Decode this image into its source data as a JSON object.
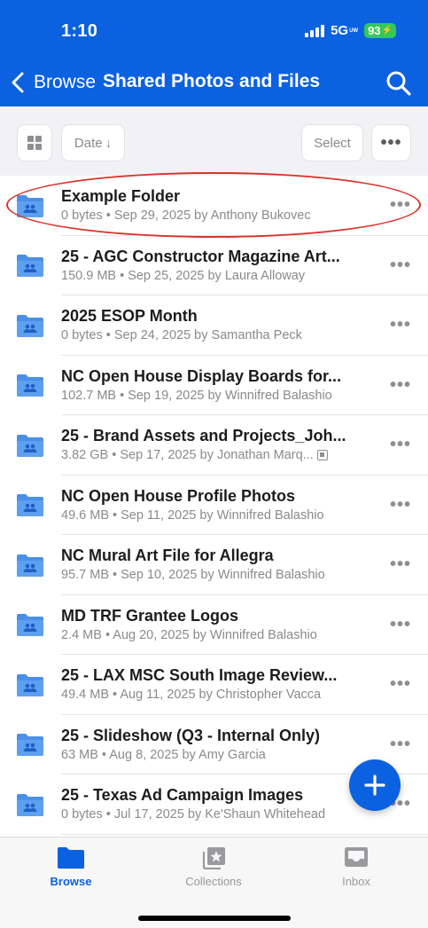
{
  "status_bar": {
    "time": "1:10",
    "network": "5G",
    "network_sub": "UW",
    "battery": "93"
  },
  "nav": {
    "back_label": "Browse",
    "title": "Shared Photos and Files"
  },
  "toolbar": {
    "sort_label": "Date",
    "select_label": "Select",
    "more_label": "•••"
  },
  "items": [
    {
      "name": "Example Folder",
      "meta": "0 bytes • Sep 29, 2025 by Anthony Bukovec",
      "highlighted": true
    },
    {
      "name": "25 - AGC Constructor Magazine Art...",
      "meta": "150.9 MB • Sep 25, 2025 by Laura Alloway"
    },
    {
      "name": "2025 ESOP Month",
      "meta": "0 bytes • Sep 24, 2025 by Samantha Peck"
    },
    {
      "name": "NC Open House Display Boards for...",
      "meta": "102.7 MB • Sep 19, 2025 by Winnifred Balashio"
    },
    {
      "name": "25 - Brand Assets and Projects_Joh...",
      "meta": "3.82 GB • Sep 17, 2025 by Jonathan Marq...",
      "has_shared_icon": true
    },
    {
      "name": "NC Open House Profile Photos",
      "meta": "49.6 MB • Sep 11, 2025 by Winnifred Balashio"
    },
    {
      "name": "NC Mural Art File for Allegra",
      "meta": "95.7 MB • Sep 10, 2025 by Winnifred Balashio"
    },
    {
      "name": "MD TRF Grantee Logos",
      "meta": "2.4 MB • Aug 20, 2025 by Winnifred Balashio"
    },
    {
      "name": "25 - LAX MSC South Image Review...",
      "meta": "49.4 MB • Aug 11, 2025 by Christopher Vacca"
    },
    {
      "name": "25 - Slideshow (Q3 - Internal Only)",
      "meta": "63 MB • Aug 8, 2025 by Amy Garcia"
    },
    {
      "name": "25 - Texas Ad Campaign Images",
      "meta": "0 bytes • Jul 17, 2025 by Ke'Shaun Whitehead"
    }
  ],
  "row_more_label": "•••",
  "tabs": [
    {
      "label": "Browse",
      "icon": "folder-icon",
      "active": true
    },
    {
      "label": "Collections",
      "icon": "collections-icon",
      "active": false
    },
    {
      "label": "Inbox",
      "icon": "inbox-icon",
      "active": false
    }
  ],
  "colors": {
    "brand": "#0b61e0",
    "highlight": "#d9342b",
    "battery": "#34c759"
  }
}
